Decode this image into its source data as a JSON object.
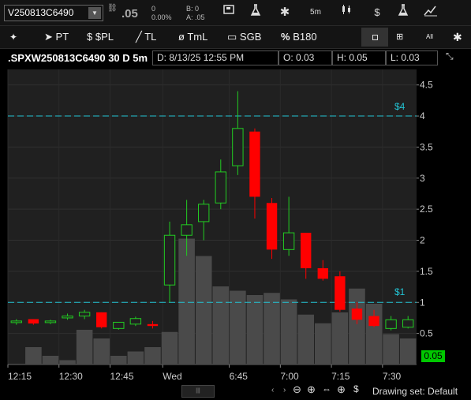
{
  "toolbar": {
    "symbol": "V250813C6490",
    "last_price": ".05",
    "change": "0",
    "change_pct": "0.00%",
    "bid": "B: 0",
    "ask": "A: .05",
    "interval": "5m",
    "dollar_label": "$"
  },
  "drawing_tools": {
    "pt": "PT",
    "spl": "$PL",
    "tl": "TL",
    "tml": "TmL",
    "sgb": "SGB",
    "b180": "B180"
  },
  "chart_header": {
    "title": ".SPXW250813C6490 30 D 5m",
    "date": "D: 8/13/25 12:55 PM",
    "open": "O: 0.03",
    "high": "H: 0.05",
    "low": "L: 0.03"
  },
  "price_lines": {
    "upper": "$4",
    "lower": "$1"
  },
  "current_price_badge": "0.05",
  "footer": {
    "drawing_set": "Drawing set: Default"
  },
  "colors": {
    "up": "#22cc22",
    "down": "#ff0000",
    "volume": "#4a4a4a",
    "line": "#22c4d4",
    "badge": "#00c800"
  },
  "chart_data": {
    "type": "candlestick",
    "y_ticks": [
      "0.5",
      "1",
      "1.5",
      "2",
      "2.5",
      "3",
      "3.5",
      "4",
      "4.5"
    ],
    "x_ticks": [
      "12:15",
      "12:30",
      "12:45",
      "Wed",
      "6:45",
      "7:00",
      "7:15",
      "7:30"
    ],
    "ylim": [
      0,
      4.75
    ],
    "horizontal_lines": [
      4,
      1
    ],
    "candles": [
      {
        "o": 0.68,
        "h": 0.73,
        "l": 0.64,
        "c": 0.7
      },
      {
        "o": 0.73,
        "h": 0.73,
        "l": 0.64,
        "c": 0.66
      },
      {
        "o": 0.68,
        "h": 0.72,
        "l": 0.65,
        "c": 0.7
      },
      {
        "o": 0.75,
        "h": 0.82,
        "l": 0.72,
        "c": 0.78
      },
      {
        "o": 0.78,
        "h": 0.88,
        "l": 0.73,
        "c": 0.84
      },
      {
        "o": 0.84,
        "h": 0.84,
        "l": 0.58,
        "c": 0.6
      },
      {
        "o": 0.58,
        "h": 0.68,
        "l": 0.56,
        "c": 0.68
      },
      {
        "o": 0.65,
        "h": 0.77,
        "l": 0.62,
        "c": 0.74
      },
      {
        "o": 0.65,
        "h": 0.7,
        "l": 0.58,
        "c": 0.62
      },
      {
        "o": 1.28,
        "h": 2.3,
        "l": 1.0,
        "c": 2.08
      },
      {
        "o": 2.08,
        "h": 2.65,
        "l": 1.75,
        "c": 2.25
      },
      {
        "o": 2.3,
        "h": 2.65,
        "l": 2.0,
        "c": 2.58
      },
      {
        "o": 2.6,
        "h": 3.3,
        "l": 2.5,
        "c": 3.1
      },
      {
        "o": 3.2,
        "h": 4.4,
        "l": 3.05,
        "c": 3.8
      },
      {
        "o": 3.75,
        "h": 3.8,
        "l": 2.35,
        "c": 2.7
      },
      {
        "o": 2.6,
        "h": 2.68,
        "l": 1.7,
        "c": 1.85
      },
      {
        "o": 1.85,
        "h": 2.7,
        "l": 1.75,
        "c": 2.12
      },
      {
        "o": 2.12,
        "h": 2.12,
        "l": 1.38,
        "c": 1.55
      },
      {
        "o": 1.55,
        "h": 1.68,
        "l": 1.35,
        "c": 1.38
      },
      {
        "o": 1.42,
        "h": 1.5,
        "l": 0.85,
        "c": 0.88
      },
      {
        "o": 0.9,
        "h": 1.0,
        "l": 0.65,
        "c": 0.72
      },
      {
        "o": 0.78,
        "h": 0.88,
        "l": 0.6,
        "c": 0.62
      },
      {
        "o": 0.58,
        "h": 0.78,
        "l": 0.55,
        "c": 0.72
      },
      {
        "o": 0.6,
        "h": 0.78,
        "l": 0.58,
        "c": 0.72
      }
    ],
    "volume": [
      0,
      40,
      20,
      10,
      80,
      60,
      20,
      30,
      40,
      75,
      290,
      250,
      180,
      170,
      160,
      165,
      150,
      115,
      95,
      120,
      175,
      140,
      70,
      60
    ]
  }
}
